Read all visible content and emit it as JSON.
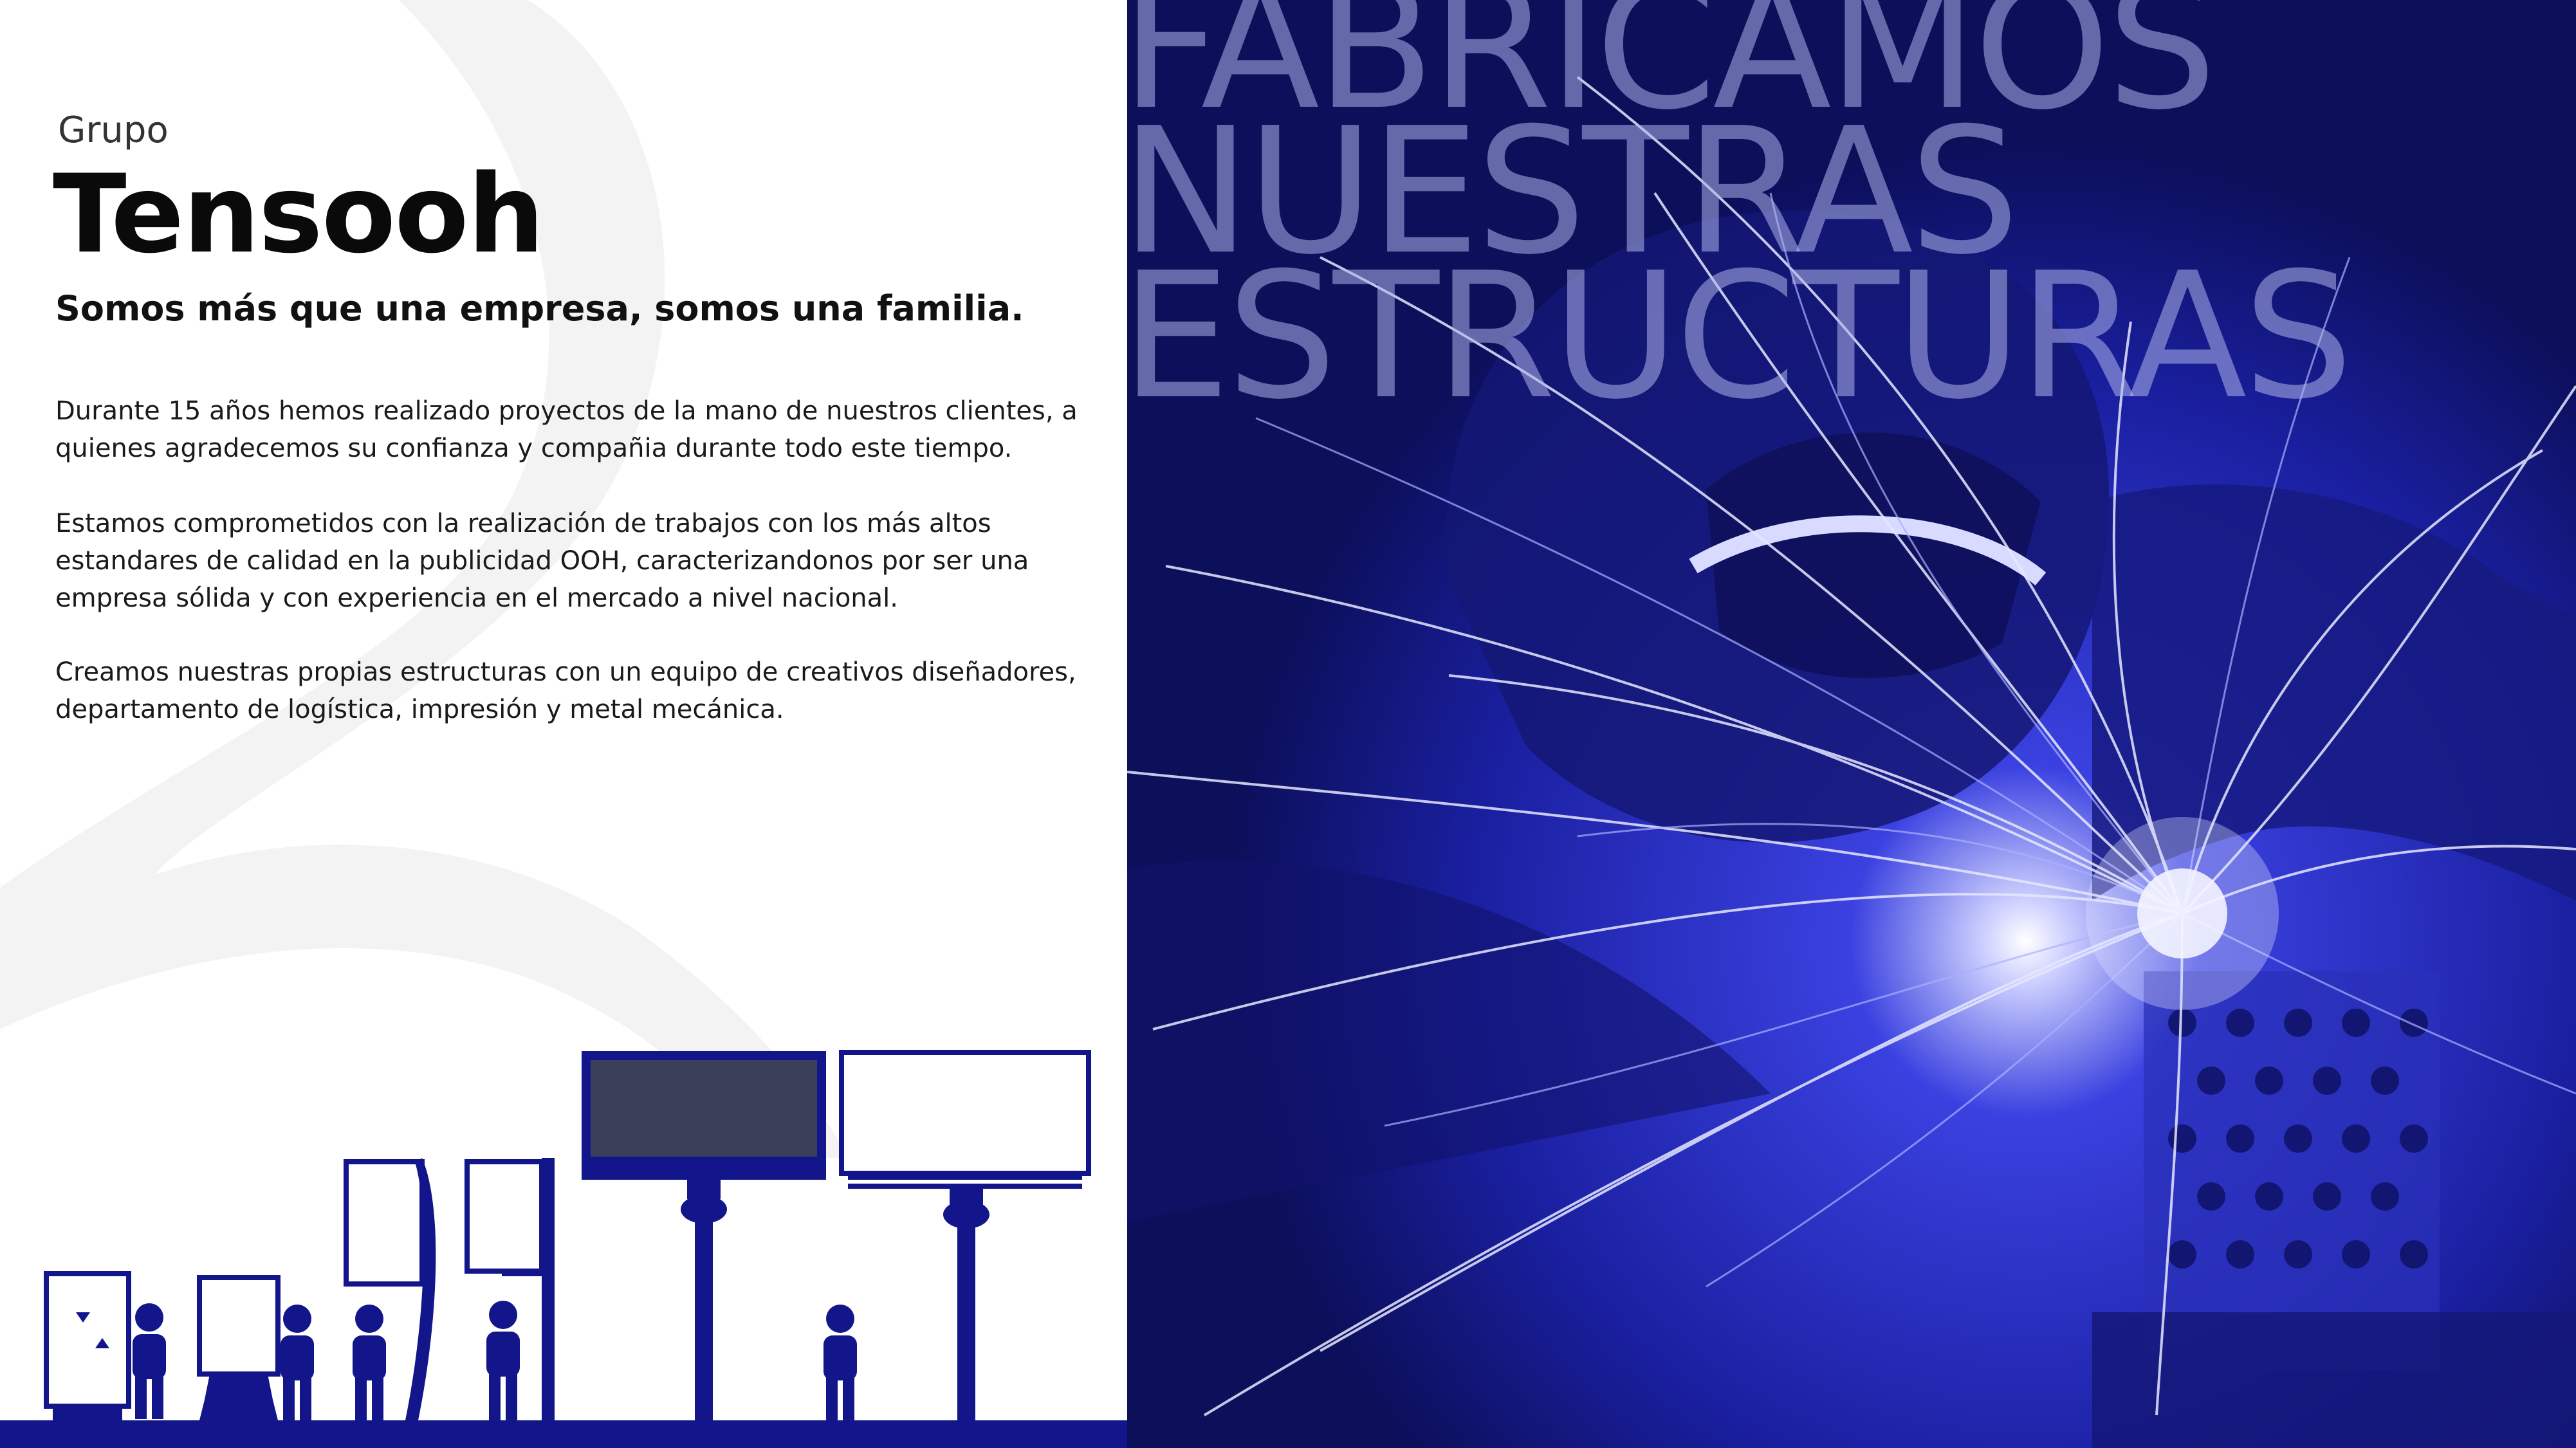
{
  "brand": {
    "prefix": "Grupo",
    "name": "Tensooh"
  },
  "tagline": "Somos más que una empresa, somos una familia.",
  "paragraphs": [
    "Durante 15 años hemos realizado proyectos de la mano de nuestros clientes, a quienes agradecemos su confianza y compañia durante todo este tiempo.",
    "Estamos comprometidos con la realización de trabajos con los más altos estandares de calidad en la publicidad OOH, caracterizandonos por ser una empresa sólida y con experiencia en el mercado a nivel nacional.",
    "Creamos nuestras propias estructuras con un equipo de creativos diseñadores, departamento de logística, impresión y metal mecánica."
  ],
  "headline": [
    "FABRICAMOS",
    "NUESTRAS",
    "ESTRUCTURAS"
  ],
  "colors": {
    "brand_navy": "#12168a",
    "photo_blue": "#2a2fd0",
    "headline_tint": "#b0b4eb"
  }
}
